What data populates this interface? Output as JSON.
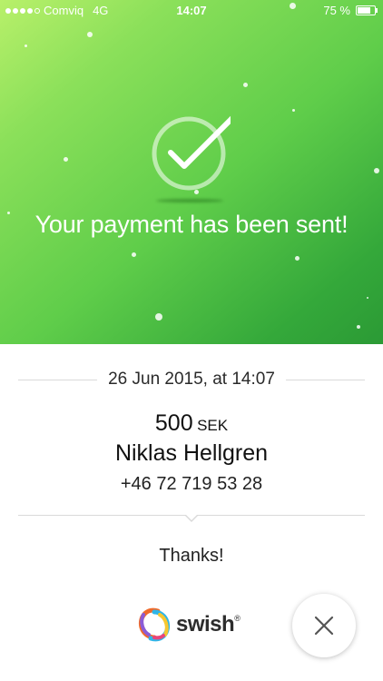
{
  "status_bar": {
    "carrier": "Comviq",
    "network": "4G",
    "time": "14:07",
    "battery": "75 %"
  },
  "header": {
    "title": "Your payment has been sent!",
    "icon": "checkmark-circle-icon"
  },
  "payment": {
    "date": "26 Jun 2015, at 14:07",
    "amount": "500",
    "currency": "SEK",
    "recipient_name": "Niklas Hellgren",
    "recipient_phone": "+46 72 719 53 28",
    "message": "Thanks!"
  },
  "footer": {
    "brand": "swish",
    "close_icon": "close-icon"
  },
  "colors": {
    "gradient_start": "#b8f06a",
    "gradient_end": "#2b9a35",
    "text": "#222222",
    "divider": "#d9d9d9"
  }
}
